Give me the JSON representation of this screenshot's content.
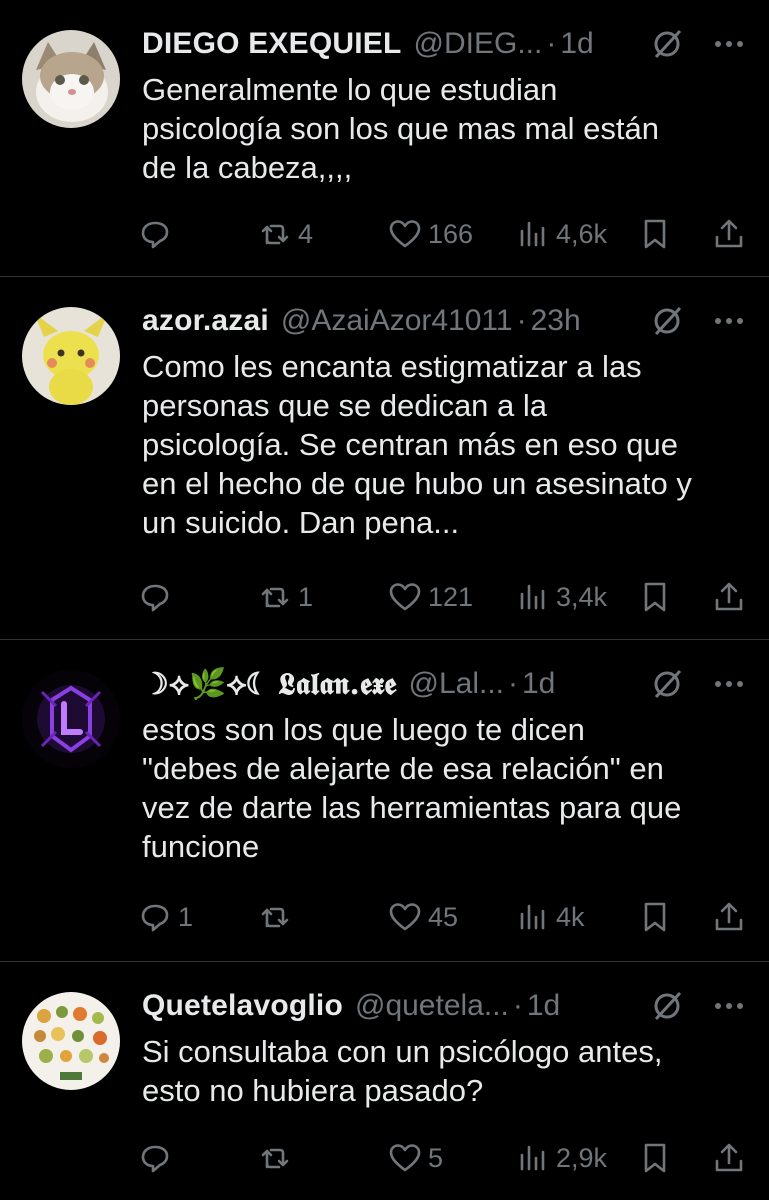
{
  "tweets": [
    {
      "name": "DIEGO EXEQUIEL",
      "handle": "@DIEG...",
      "separator": "·",
      "time": "1d",
      "text": "Generalmente lo que estudian\npsicología son los que mas mal están\nde la cabeza,,,,",
      "replies": "",
      "retweets": "4",
      "likes": "166",
      "views": "4,6k",
      "avatar": "cat-avatar"
    },
    {
      "name": "azor.azai",
      "handle": "@AzaiAzor41011",
      "separator": "·",
      "time": "23h",
      "text": "Como les encanta estigmatizar a las\npersonas que se dedican a la\npsicología. Se centran más en eso que\nen el hecho de que hubo un asesinato y\nun suicido. Dan pena...",
      "replies": "",
      "retweets": "1",
      "likes": "121",
      "views": "3,4k",
      "avatar": "plush-avatar"
    },
    {
      "name": "☽⟡🌿⟡☾ 𝕷𝖆𝖑𝖆𝖓.𝖊𝖝𝖊",
      "handle": "@Lal...",
      "separator": "·",
      "time": "1d",
      "text": "estos son los que luego te dicen\n\"debes de alejarte de esa relación\" en\nvez de darte las herramientas para que\nfuncione",
      "replies": "1",
      "retweets": "",
      "likes": "45",
      "views": "4k",
      "avatar": "purple-emblem-avatar"
    },
    {
      "name": "Quetelavoglio",
      "handle": "@quetela...",
      "separator": "·",
      "time": "1d",
      "text": "Si consultaba con un psicólogo antes,\nesto no hubiera pasado?",
      "replies": "",
      "retweets": "",
      "likes": "5",
      "views": "2,9k",
      "avatar": "vegetables-avatar"
    }
  ],
  "icons": {
    "reply": "reply-icon",
    "retweet": "retweet-icon",
    "like": "heart-icon",
    "views": "views-icon",
    "bookmark": "bookmark-icon",
    "share": "share-icon",
    "grok": "grok-icon",
    "more": "more-icon"
  },
  "colors": {
    "background": "#000000",
    "text": "#e7e9ea",
    "muted": "#71767b",
    "divider": "#2f3336"
  }
}
